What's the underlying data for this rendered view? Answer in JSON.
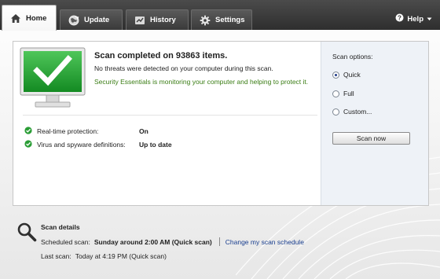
{
  "tabs": [
    {
      "label": "Home",
      "icon": "home-icon",
      "active": true
    },
    {
      "label": "Update",
      "icon": "update-globe-icon",
      "active": false
    },
    {
      "label": "History",
      "icon": "history-icon",
      "active": false
    },
    {
      "label": "Settings",
      "icon": "gear-icon",
      "active": false
    }
  ],
  "help": {
    "label": "Help",
    "icon": "help-icon"
  },
  "status": {
    "title": "Scan completed on 93863 items.",
    "subtitle": "No threats were detected on your computer during this scan.",
    "message": "Security Essentials is monitoring your computer and helping to protect it.",
    "icon": "protected-monitor-checkmark-icon",
    "state_color": "#1f9a2c",
    "message_color": "#3a7d14"
  },
  "protection": [
    {
      "label": "Real-time protection:",
      "value": "On",
      "icon": "green-check-icon"
    },
    {
      "label": "Virus and spyware definitions:",
      "value": "Up to date",
      "icon": "green-check-icon"
    }
  ],
  "scan_options": {
    "title": "Scan options:",
    "options": [
      {
        "label": "Quick",
        "selected": true
      },
      {
        "label": "Full",
        "selected": false
      },
      {
        "label": "Custom...",
        "selected": false
      }
    ],
    "button_label": "Scan now"
  },
  "scan_details": {
    "title": "Scan details",
    "icon": "magnifier-icon",
    "scheduled_label": "Scheduled scan:",
    "scheduled_value": "Sunday around 2:00 AM (Quick scan)",
    "change_link": "Change my scan schedule",
    "last_scan_label": "Last scan:",
    "last_scan_value": "Today at 4:19 PM (Quick scan)",
    "link_color": "#1a3f8f"
  }
}
